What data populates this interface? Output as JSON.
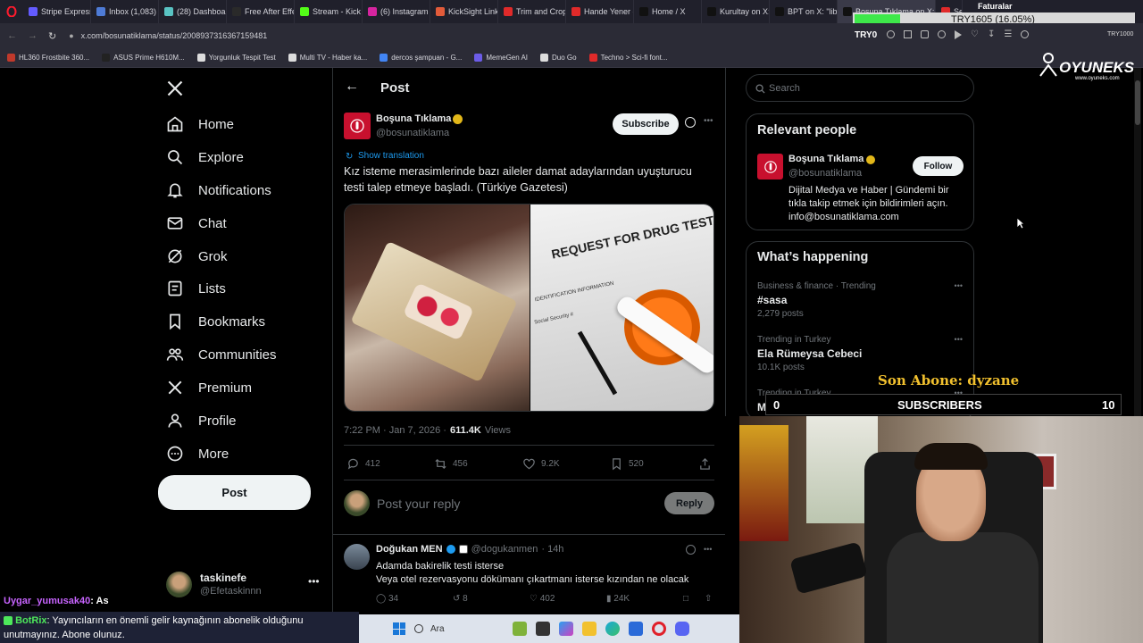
{
  "browser": {
    "tabs": [
      {
        "label": "Stripe Express",
        "color": "#635bff"
      },
      {
        "label": "Inbox (1,083) -",
        "color": "#4e7bd6"
      },
      {
        "label": "(28) Dashboard",
        "color": "#59c3c3"
      },
      {
        "label": "Free After Effec",
        "color": "#2a2a2a"
      },
      {
        "label": "Stream - Kick D",
        "color": "#53fc18"
      },
      {
        "label": "(6) Instagram",
        "color": "#d6249f"
      },
      {
        "label": "KickSight Link",
        "color": "#e25b3a"
      },
      {
        "label": "Trim and Crop",
        "color": "#e02a2a"
      },
      {
        "label": "Hande Yener -",
        "color": "#e02a2a"
      },
      {
        "label": "Home / X",
        "color": "#111111"
      },
      {
        "label": "Kurultay on X:",
        "color": "#111111"
      },
      {
        "label": "BPT on X: \"libe",
        "color": "#111111"
      },
      {
        "label": "Boşuna Tıklama on X: \"K",
        "color": "#111111"
      },
      {
        "label": "Se",
        "color": "#e02a2a"
      }
    ],
    "url": "x.com/bosunatiklama/status/2008937316367159481",
    "bookmarks": [
      {
        "label": "HL360 Frostbite 360...",
        "color": "#c0392b"
      },
      {
        "label": "ASUS Prime H610M...",
        "color": "#222222"
      },
      {
        "label": "Yorgunluk Tespit Test",
        "color": "#dddddd"
      },
      {
        "label": "Multi TV - Haber ka...",
        "color": "#dddddd"
      },
      {
        "label": "dercos şampuan - G...",
        "color": "#4285f4"
      },
      {
        "label": "MemeGen AI",
        "color": "#6c5ce7"
      },
      {
        "label": "Duo Go",
        "color": "#dddddd"
      },
      {
        "label": "Techno > Sci-fi font...",
        "color": "#e02a2a"
      }
    ]
  },
  "overlay": {
    "ticker_text": "TRY1605 (16.05%)",
    "ticker_label": "TRY0",
    "ticker_right": "TRY1000",
    "faturalar": "Faturalar",
    "oyuneks_brand": "OYUNEKS",
    "oyuneks_site": "www.oyuneks.com",
    "son_abone": "Son Abone: dyzane",
    "subscribers_label": "SUBSCRIBERS",
    "subscribers_left": "0",
    "subscribers_count": "10",
    "chat": [
      {
        "user": "Uygar_yumusak40",
        "text": ": As",
        "color": "#c864ff"
      },
      {
        "user": "BotRix",
        "text": ": Yayıncıların en önemli gelir kaynağının abonelik olduğunu unutmayınız. Abone olunuz.",
        "color": "#4de85b"
      }
    ]
  },
  "nav": {
    "items": [
      "Home",
      "Explore",
      "Notifications",
      "Chat",
      "Grok",
      "Lists",
      "Bookmarks",
      "Communities",
      "Premium",
      "Profile",
      "More"
    ],
    "post_button": "Post",
    "account_name": "taskinefe",
    "account_handle": "@Efetaskinnn"
  },
  "post": {
    "header_title": "Post",
    "author_name": "Boşuna Tıklama",
    "author_handle": "@bosunatiklama",
    "subscribe_label": "Subscribe",
    "show_translation": "Show translation",
    "text": "Kız isteme merasimlerinde bazı aileler damat adaylarından uyuşturucu testi talep etmeye başladı. (Türkiye Gazetesi)",
    "image_text_request": "REQUEST FOR DRUG TEST",
    "image_text_ident": "IDENTIFICATION INFORMATION",
    "image_text_ssn": "Social Security #",
    "time": "7:22 PM · Jan 7, 2026 ·",
    "views_count": "611.4K",
    "views_label": "Views",
    "replies": "412",
    "reposts": "456",
    "likes": "9.2K",
    "bookmarks": "520",
    "reply_placeholder": "Post your reply",
    "reply_button": "Reply"
  },
  "reply": {
    "author_name": "Doğukan MEN",
    "author_handle": "@dogukanmen",
    "time": "· 14h",
    "text": "Adamda bakirelik testi isterse\nVeya otel rezervasyonu dökümanı çıkartmanı isterse kızından ne olacak",
    "replies": "34",
    "reposts": "8",
    "likes": "402",
    "views": "24K"
  },
  "sidebar": {
    "search_placeholder": "Search",
    "relevant_title": "Relevant people",
    "person_name": "Boşuna Tıklama",
    "person_handle": "@bosunatiklama",
    "follow_label": "Follow",
    "person_bio": "Dijital Medya ve Haber | Gündemi bir tıkla takip etmek için bildirimleri açın. info@bosunatiklama.com",
    "happening_title": "What’s happening",
    "trends": [
      {
        "meta": "Business & finance · Trending",
        "name": "#sasa",
        "count": "2,279 posts"
      },
      {
        "meta": "Trending in Turkey",
        "name": "Ela Rümeysa Cebeci",
        "count": "10.1K posts"
      },
      {
        "meta": "Trending in Turkey",
        "name": "Meteorolojik Uyarı",
        "count": ""
      }
    ]
  },
  "taskbar": {
    "search_label": "Ara"
  },
  "colors": {
    "accent": "#1d9bf0",
    "verified_gold": "#e2b719",
    "brand_red": "#c8102e"
  }
}
